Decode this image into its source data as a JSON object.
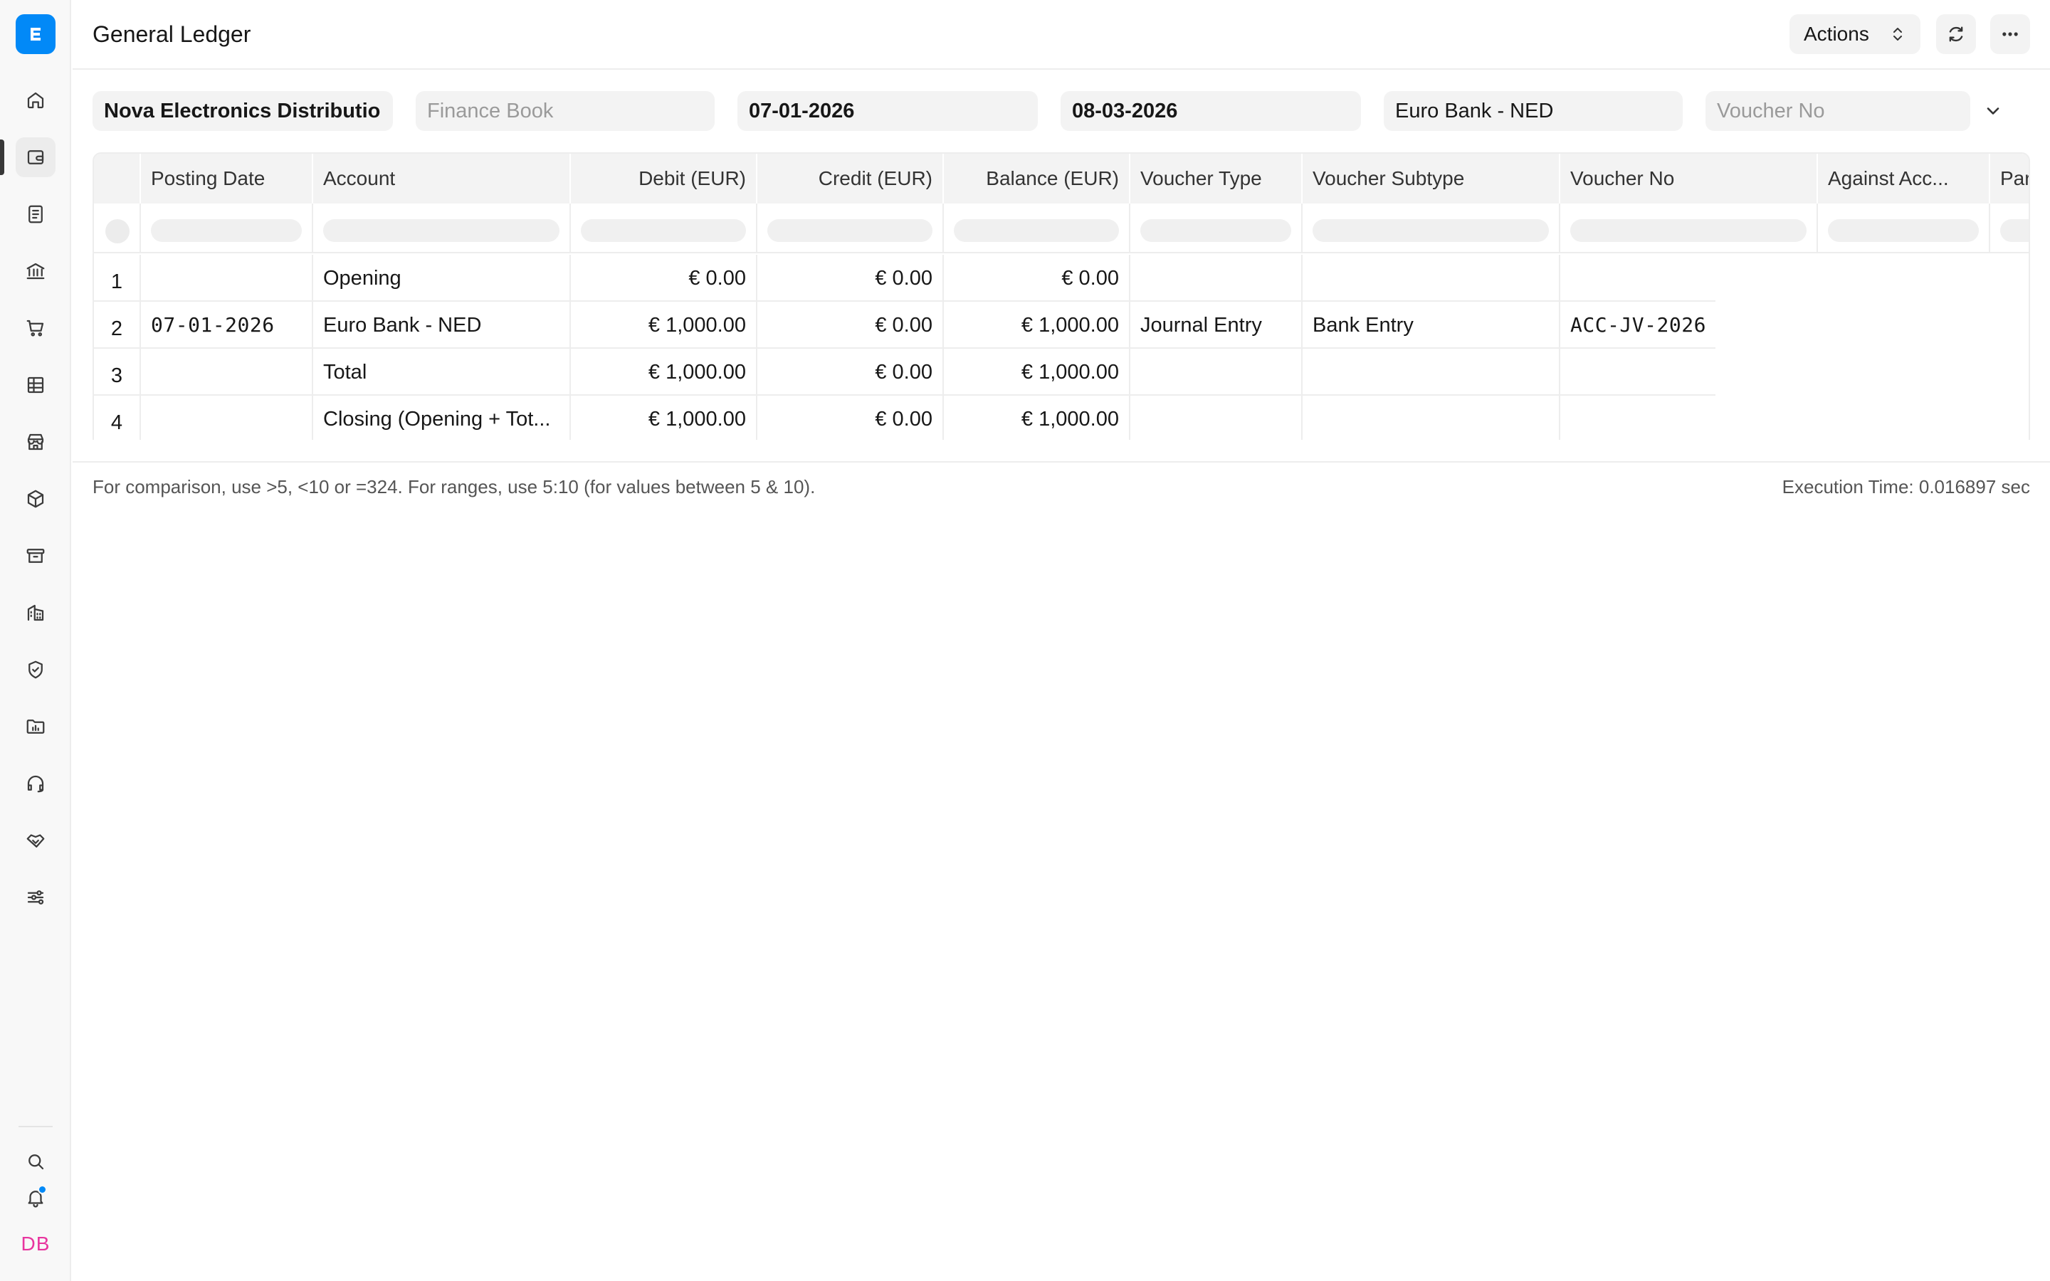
{
  "sidebar": {
    "logo_icon": "app-logo-icon",
    "items": [
      {
        "icon": "home-icon",
        "active": false
      },
      {
        "icon": "wallet-icon",
        "active": true
      },
      {
        "icon": "invoice-icon",
        "active": false
      },
      {
        "icon": "bank-icon",
        "active": false
      },
      {
        "icon": "cart-icon",
        "active": false
      },
      {
        "icon": "table-icon",
        "active": false
      },
      {
        "icon": "store-icon",
        "active": false
      },
      {
        "icon": "package-icon",
        "active": false
      },
      {
        "icon": "archive-icon",
        "active": false
      },
      {
        "icon": "buildings-icon",
        "active": false
      },
      {
        "icon": "shield-icon",
        "active": false
      },
      {
        "icon": "folder-chart-icon",
        "active": false
      },
      {
        "icon": "headset-icon",
        "active": false
      },
      {
        "icon": "handshake-icon",
        "active": false
      },
      {
        "icon": "sliders-icon",
        "active": false
      }
    ],
    "bottom": {
      "search_icon": "search-icon",
      "bell_icon": "bell-icon",
      "avatar_initials": "DB"
    }
  },
  "header": {
    "title": "General Ledger",
    "actions_label": "Actions"
  },
  "filters": {
    "company": "Nova Electronics Distributio",
    "finance_book_placeholder": "Finance Book",
    "from_date": "07-01-2026",
    "to_date": "08-03-2026",
    "account": "Euro Bank - NED",
    "voucher_no_placeholder": "Voucher No"
  },
  "table": {
    "columns": [
      "Posting Date",
      "Account",
      "Debit (EUR)",
      "Credit (EUR)",
      "Balance (EUR)",
      "Voucher Type",
      "Voucher Subtype",
      "Voucher No",
      "Against Acc...",
      "Par"
    ],
    "rows": [
      {
        "idx": "1",
        "posting_date": "",
        "account": "Opening",
        "debit": "€ 0.00",
        "credit": "€ 0.00",
        "balance": "€ 0.00",
        "voucher_type": "",
        "voucher_subtype": "",
        "voucher_no": ""
      },
      {
        "idx": "2",
        "posting_date": "07-01-2026",
        "account": "Euro Bank - NED",
        "debit": "€ 1,000.00",
        "credit": "€ 0.00",
        "balance": "€ 1,000.00",
        "voucher_type": "Journal Entry",
        "voucher_subtype": "Bank Entry",
        "voucher_no": "ACC-JV-2026"
      },
      {
        "idx": "3",
        "posting_date": "",
        "account": "Total",
        "debit": "€ 1,000.00",
        "credit": "€ 0.00",
        "balance": "€ 1,000.00",
        "voucher_type": "",
        "voucher_subtype": "",
        "voucher_no": ""
      },
      {
        "idx": "4",
        "posting_date": "",
        "account": "Closing (Opening + Tot...",
        "debit": "€ 1,000.00",
        "credit": "€ 0.00",
        "balance": "€ 1,000.00",
        "voucher_type": "",
        "voucher_subtype": "",
        "voucher_no": ""
      }
    ]
  },
  "footer": {
    "hint": "For comparison, use >5, <10 or =324. For ranges, use 5:10 (for values between 5 & 10).",
    "execution_time": "Execution Time: 0.016897 sec"
  },
  "colors": {
    "accent": "#0289f7",
    "avatar": "#e8359f"
  }
}
